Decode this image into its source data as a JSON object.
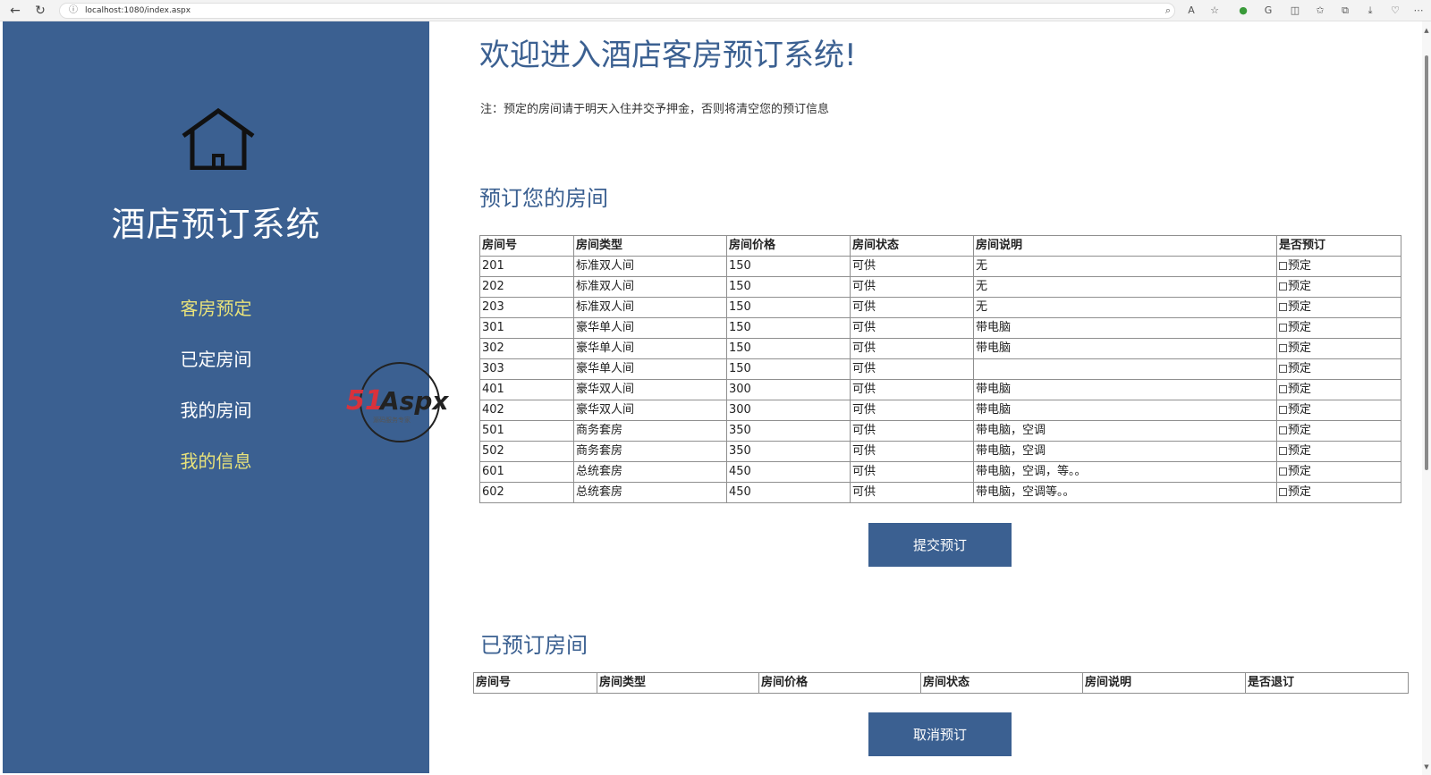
{
  "browser": {
    "url": "localhost:1080/index.aspx"
  },
  "sidebar": {
    "title": "酒店预订系统",
    "menu": [
      {
        "label": "客房预定",
        "highlight": true
      },
      {
        "label": "已定房间",
        "highlight": false
      },
      {
        "label": "我的房间",
        "highlight": false
      },
      {
        "label": "我的信息",
        "highlight": true
      }
    ],
    "watermark": {
      "brand": "51Aspx",
      "tagline": "源码服务专家"
    }
  },
  "main": {
    "title": "欢迎进入酒店客房预订系统!",
    "note": "注：预定的房间请于明天入住并交予押金，否则将清空您的预订信息",
    "book_section": {
      "title": "预订您的房间",
      "columns": [
        "房间号",
        "房间类型",
        "房间价格",
        "房间状态",
        "房间说明",
        "是否预订"
      ],
      "checkbox_label": "预定",
      "rows": [
        [
          "201",
          "标准双人间",
          "150",
          "可供",
          "无"
        ],
        [
          "202",
          "标准双人间",
          "150",
          "可供",
          "无"
        ],
        [
          "203",
          "标准双人间",
          "150",
          "可供",
          "无"
        ],
        [
          "301",
          "豪华单人间",
          "150",
          "可供",
          "带电脑"
        ],
        [
          "302",
          "豪华单人间",
          "150",
          "可供",
          "带电脑"
        ],
        [
          "303",
          "豪华单人间",
          "150",
          "可供",
          ""
        ],
        [
          "401",
          "豪华双人间",
          "300",
          "可供",
          "带电脑"
        ],
        [
          "402",
          "豪华双人间",
          "300",
          "可供",
          "带电脑"
        ],
        [
          "501",
          "商务套房",
          "350",
          "可供",
          "带电脑，空调"
        ],
        [
          "502",
          "商务套房",
          "350",
          "可供",
          "带电脑，空调"
        ],
        [
          "601",
          "总统套房",
          "450",
          "可供",
          "带电脑，空调，等。。"
        ],
        [
          "602",
          "总统套房",
          "450",
          "可供",
          "带电脑，空调等。。"
        ]
      ],
      "submit_label": "提交预订"
    },
    "booked_section": {
      "title": "已预订房间",
      "columns": [
        "房间号",
        "房间类型",
        "房间价格",
        "房间状态",
        "房间说明",
        "是否退订"
      ],
      "cancel_label": "取消预订"
    }
  },
  "colors": {
    "sidebar_bg": "#3b6091",
    "menu_highlight": "#e8e27a",
    "button_bg": "#3b6091",
    "title_color": "#3b6091"
  }
}
